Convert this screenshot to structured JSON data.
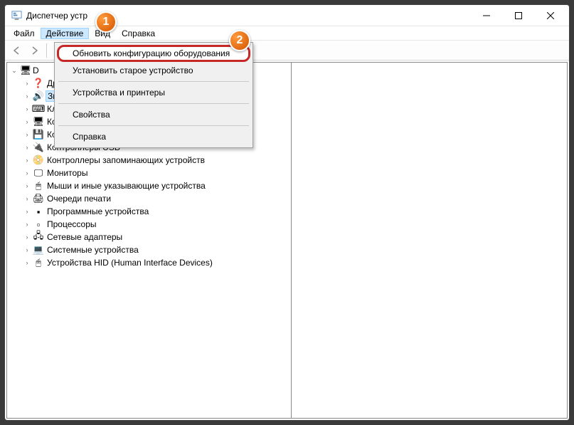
{
  "window": {
    "title": "Диспетчер устр"
  },
  "menubar": {
    "file": "Файл",
    "action": "Действие",
    "view": "Вид",
    "help": "Справка"
  },
  "dropdown": {
    "scan": "Обновить конфигурацию оборудования",
    "legacy": "Установить старое устройство",
    "devprinters": "Устройства и принтеры",
    "properties": "Свойства",
    "help": "Справка"
  },
  "tree": {
    "root": "D",
    "items": [
      {
        "label": "Другие устройства",
        "icon": "❓"
      },
      {
        "label": "Звуковые, игровые и видеоустройства",
        "icon": "🔊",
        "selected": true
      },
      {
        "label": "Клавиатуры",
        "icon": "⌨"
      },
      {
        "label": "Компьютер",
        "icon": "🖥"
      },
      {
        "label": "Контроллеры IDE ATA/ATAPI",
        "icon": "💾"
      },
      {
        "label": "Контроллеры USB",
        "icon": "🔌"
      },
      {
        "label": "Контроллеры запоминающих устройств",
        "icon": "📀"
      },
      {
        "label": "Мониторы",
        "icon": "🖵"
      },
      {
        "label": "Мыши и иные указывающие устройства",
        "icon": "🖱"
      },
      {
        "label": "Очереди печати",
        "icon": "🖨"
      },
      {
        "label": "Программные устройства",
        "icon": "▪"
      },
      {
        "label": "Процессоры",
        "icon": "▫"
      },
      {
        "label": "Сетевые адаптеры",
        "icon": "🖧"
      },
      {
        "label": "Системные устройства",
        "icon": "💻"
      },
      {
        "label": "Устройства HID (Human Interface Devices)",
        "icon": "🖰"
      }
    ]
  },
  "annotations": {
    "one": "1",
    "two": "2"
  }
}
